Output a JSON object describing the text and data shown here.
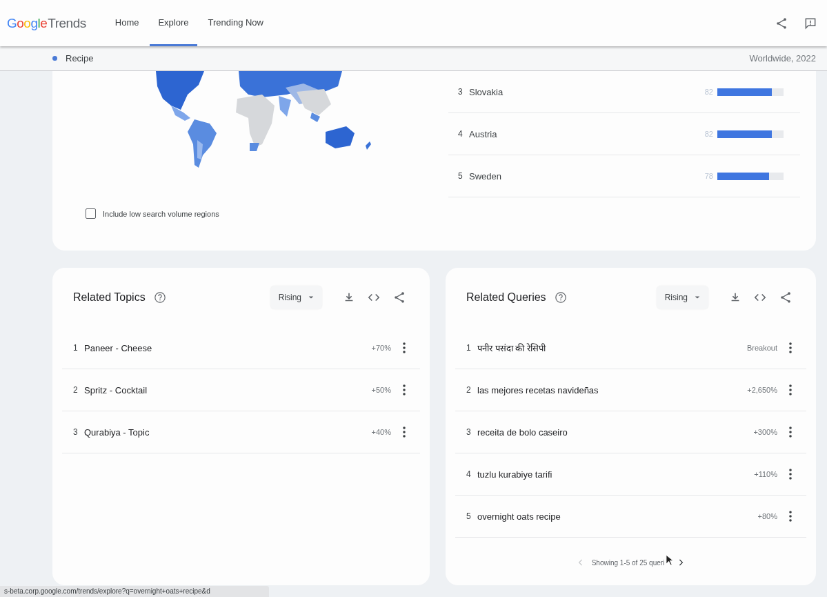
{
  "header": {
    "logo": {
      "brand": "Google",
      "product": "Trends"
    },
    "nav": [
      {
        "label": "Home",
        "selected": false
      },
      {
        "label": "Explore",
        "selected": true
      },
      {
        "label": "Trending Now",
        "selected": false
      }
    ]
  },
  "query_bar": {
    "term": "Recipe",
    "scope": "Worldwide, 2022"
  },
  "regions": {
    "rows": [
      {
        "rank": "3",
        "name": "Slovakia",
        "value": "82",
        "level": 0.82
      },
      {
        "rank": "4",
        "name": "Austria",
        "value": "82",
        "level": 0.82
      },
      {
        "rank": "5",
        "name": "Sweden",
        "value": "78",
        "level": 0.78
      }
    ],
    "low_volume_checkbox": {
      "label": "Include low search volume regions",
      "checked": false
    }
  },
  "related_topics": {
    "title": "Related Topics",
    "filter": "Rising",
    "rows": [
      {
        "rank": "1",
        "name": "Paneer - Cheese",
        "value": "+70%"
      },
      {
        "rank": "2",
        "name": "Spritz - Cocktail",
        "value": "+50%"
      },
      {
        "rank": "3",
        "name": "Qurabiya - Topic",
        "value": "+40%"
      }
    ]
  },
  "related_queries": {
    "title": "Related Queries",
    "filter": "Rising",
    "rows": [
      {
        "rank": "1",
        "name": "पनीर पसंदा की रेसिपी",
        "value": "Breakout"
      },
      {
        "rank": "2",
        "name": "las mejores recetas navideñas",
        "value": "+2,650%"
      },
      {
        "rank": "3",
        "name": "receita de bolo caseiro",
        "value": "+300%"
      },
      {
        "rank": "4",
        "name": "tuzlu kurabiye tarifi",
        "value": "+110%"
      },
      {
        "rank": "5",
        "name": "overnight oats recipe",
        "value": "+80%"
      }
    ],
    "pagination": "Showing 1-5 of 25 queri"
  },
  "status_bar": {
    "url": "s-beta.corp.google.com/trends/explore?q=overnight+oats+recipe&d"
  }
}
